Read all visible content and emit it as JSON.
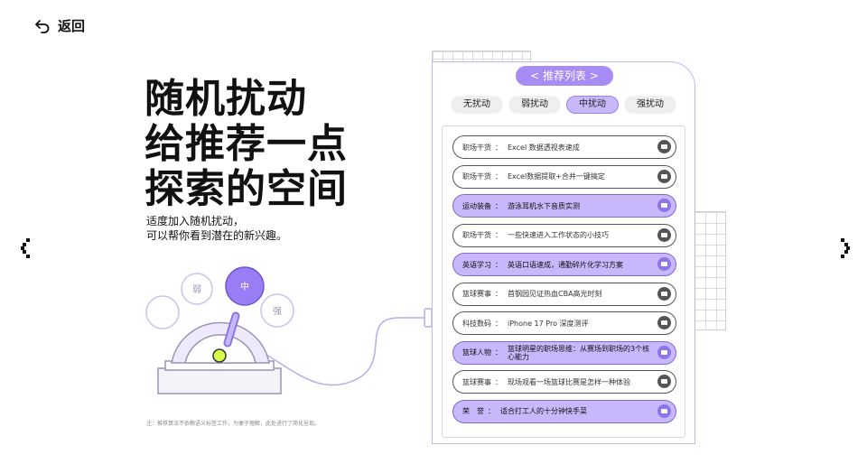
{
  "header": {
    "back_label": "返回"
  },
  "hero": {
    "lines": [
      "随机扰动",
      "给推荐一点",
      "探索的空间"
    ],
    "sub_lines": [
      "适度加入随机扰动，",
      "可以帮你看到潜在的新兴趣。"
    ],
    "footnote": "注：推荐算法不依赖语义标签工作，为便于理解，此处进行了简化呈现。"
  },
  "dial": {
    "weak": "弱",
    "mid": "中",
    "strong": "强"
  },
  "panel": {
    "title": "< 推荐列表 >",
    "tabs": [
      {
        "label": "无扰动",
        "active": false
      },
      {
        "label": "弱扰动",
        "active": false
      },
      {
        "label": "中扰动",
        "active": true
      },
      {
        "label": "强扰动",
        "active": false
      }
    ],
    "items": [
      {
        "category": "职场干货",
        "title": "Excel 数据透视表速成",
        "highlight": false
      },
      {
        "category": "职场干货",
        "title": "Excel数据提取+合并一键搞定",
        "highlight": false
      },
      {
        "category": "运动装备",
        "title": "游泳耳机水下音质实测",
        "highlight": true
      },
      {
        "category": "职场干货",
        "title": "一些快速进入工作状态的小技巧",
        "highlight": false
      },
      {
        "category": "英语学习",
        "title": "英语口语速成，通勤碎片化学习方案",
        "highlight": true
      },
      {
        "category": "篮球赛事",
        "title": "首钢园见证热血CBA高光时刻",
        "highlight": false
      },
      {
        "category": "科技数码",
        "title": "iPhone 17 Pro 深度测评",
        "highlight": false
      },
      {
        "category": "篮球人物",
        "title": "篮球明星的职场思维：从赛场到职场的3个核心能力",
        "highlight": true
      },
      {
        "category": "篮球赛事",
        "title": "现场观看一场篮球比赛是怎样一种体验",
        "highlight": false
      },
      {
        "category": "荣　誉",
        "title": "适合打工人的十分钟快手菜",
        "highlight": true
      }
    ],
    "separator": "：",
    "accent": "#c9b7fb"
  }
}
